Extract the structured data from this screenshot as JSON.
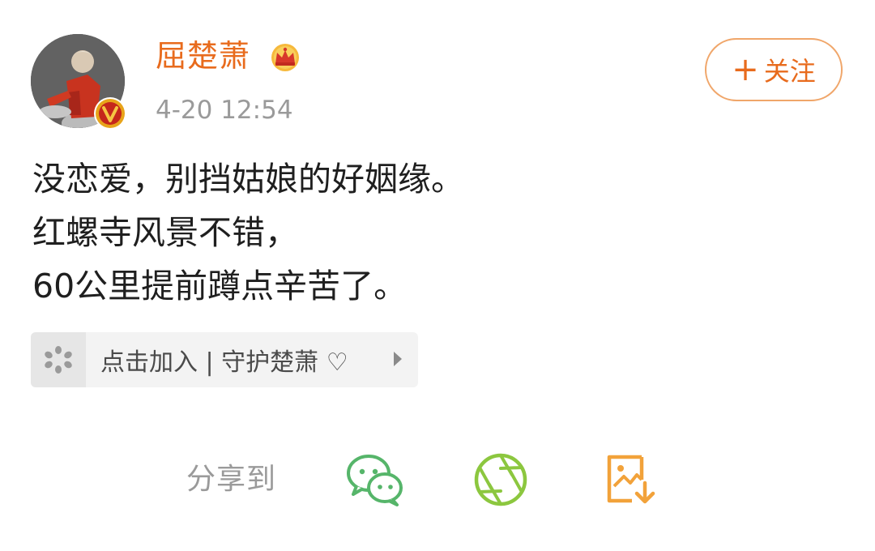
{
  "post": {
    "author": {
      "name": "屈楚萧",
      "avatar_icon": "avatar-photo",
      "badge_icon": "verified-v-badge",
      "member_icon": "crown-icon"
    },
    "timestamp": "4-20 12:54",
    "follow_button": {
      "icon": "plus-icon",
      "plus": "+",
      "label": "关注"
    },
    "content_lines": [
      "没恋爱，别挡姑娘的好姻缘。",
      "红螺寺风景不错，",
      "60公里提前蹲点辛苦了。"
    ]
  },
  "group_card": {
    "icon": "fan-group-icon",
    "label": "点击加入 | 守护楚萧 ♡",
    "arrow_icon": "chevron-right-icon"
  },
  "share": {
    "label": "分享到",
    "targets": [
      {
        "name": "wechat",
        "icon": "wechat-icon"
      },
      {
        "name": "moments",
        "icon": "moments-icon"
      },
      {
        "name": "save-image",
        "icon": "save-image-icon"
      }
    ]
  },
  "colors": {
    "username": "#e86b1d",
    "follow_border": "#f0a66a",
    "timestamp": "#9a9a9a",
    "wechat_green": "#56b56a",
    "moments_green": "#8cc73f",
    "save_orange": "#f2a23a",
    "verify_badge": "#e8a41a"
  }
}
